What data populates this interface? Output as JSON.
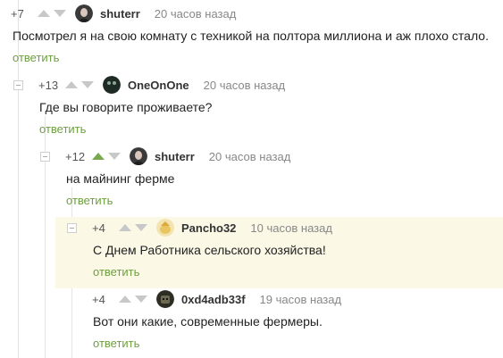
{
  "comments": [
    {
      "rating": "+7",
      "author": "shuterr",
      "time": "20 часов назад",
      "text": "Посмотрел я на свою комнату с техникой на полтора миллиона и аж плохо стало.",
      "reply": "ответить"
    },
    {
      "rating": "+13",
      "author": "OneOnOne",
      "time": "20 часов назад",
      "text": "Где вы говорите проживаете?",
      "reply": "ответить"
    },
    {
      "rating": "+12",
      "author": "shuterr",
      "time": "20 часов назад",
      "text": "на майнинг ферме",
      "reply": "ответить"
    },
    {
      "rating": "+4",
      "author": "Pancho32",
      "time": "10 часов назад",
      "text": "С Днем Работника сельского хозяйства!",
      "reply": "ответить"
    },
    {
      "rating": "+4",
      "author": "0xd4adb33f",
      "time": "19 часов назад",
      "text": "Вот они какие, современные фермеры.",
      "reply": "ответить"
    }
  ],
  "colors": {
    "reply_link": "#6da03e",
    "upvote_active": "#78a84f",
    "highlight": "#fbf8e6"
  }
}
